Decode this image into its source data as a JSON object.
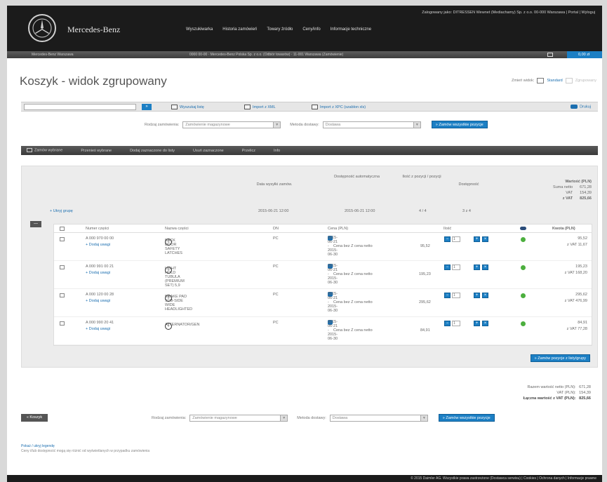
{
  "header": {
    "brand": "Mercedes-Benz",
    "top_links": "Zalogowany jako: DITRESSEN Wewnet (Mediachamy) Sp. z o.o. 00-000 Warszawa  |  Portal  |  Wyloguj",
    "nav": [
      "Wyszukiwarka",
      "Historia zamówień",
      "Towary źródło",
      "Ceny/info",
      "Informacje techniczne"
    ],
    "sub_left": "Mercedes-Benz Warszawa",
    "sub_mid": "0000 00-00 · Mercedes-Benz Polska Sp. z o.o. (Odbiór towarów) · 11-001 Warszawa (Zamówienie)",
    "cart_label": "0,00 zł"
  },
  "page": {
    "title": "Koszyk - widok zgrupowany",
    "view_label": "Zmień widok:",
    "view_standard": "Standard",
    "view_grouped": "Zgrupowany"
  },
  "actions": {
    "search_placeholder": "",
    "search_btn": "»",
    "link1": "Wyszukaj listę",
    "link2": "Import z XML",
    "link3": "Import z XPC (szablon xls)",
    "print": "Drukuj"
  },
  "filters": {
    "sort_label": "Rodzaj zamówienia:",
    "sort_value": "Zamówienie magazynowe",
    "delivery_label": "Metoda dostawy:",
    "delivery_value": "Dostawa",
    "submit": "» Zamów wszystkie pozycje"
  },
  "toolbar": [
    "Zamów wybrane",
    "Przenieś wybrane",
    "Dodaj zaznaczone do listy",
    "Usuń zaznaczone",
    "Przelicz",
    "Info"
  ],
  "group": {
    "headers": {
      "delivery_date": "Data wysyłki zamów.",
      "delivery_avail": "Dostępność automatyczna",
      "items": "Ilość z pozycji / pozycji",
      "availability": "Dostępność",
      "value": "Wartość (PLN)"
    },
    "totals": [
      {
        "label": "Suma netto",
        "value": "671,28"
      },
      {
        "label": "VAT",
        "value": "154,39"
      },
      {
        "label": "z VAT",
        "value": "825,66"
      }
    ],
    "link": "+ Ukryj grupę",
    "date1": "2015-06-21 12:00",
    "date2": "2015-06-21 12:00",
    "count": "4 / 4",
    "avail": "3 z 4",
    "collapse": "—"
  },
  "table": {
    "headers": {
      "part": "Numer części",
      "name": "Nazwa części",
      "dn": "DN",
      "price": "Cena (PLN)",
      "qty": "Ilość",
      "value": "Kwota (PLN)"
    },
    "rows": [
      {
        "part": "A 000 970 00 00",
        "link": "+ Dodaj uwagi",
        "name": "BACK DOOR SAFETY LATCHES",
        "dn": "PC",
        "date": "2015-06-21 - 2015-06-30",
        "price_label": "Cena bez Z cena netto",
        "price": "95,52",
        "qty": "1",
        "amount": "95,52",
        "amount_vat": "z VAT 11,67"
      },
      {
        "part": "A 000 991 00 21",
        "link": "+ Dodaj uwagi",
        "name": "LIGHT HOLD TUBULA (PREMIUM SET) 5,9",
        "dn": "PC",
        "date": "2015-06-21 - 2015-06-30",
        "price_label": "Cena bez Z cena netto",
        "price": "195,23",
        "qty": "1",
        "amount": "195,23",
        "amount_vat": "z VAT 168,20"
      },
      {
        "part": "A 000 120 00 28",
        "link": "+ Dodaj uwagi",
        "name": "BRAKE PAD SUB-SIDE WIDE HEADLIGHTED",
        "dn": "PC",
        "date": "2015-06-21 - 2015-06-30",
        "price_label": "Cena bez Z cena netto",
        "price": "295,62",
        "qty": "1",
        "amount": "295,62",
        "amount_vat": "z VAT 476,99"
      },
      {
        "part": "A 000 990 20 41",
        "link": "+ Dodaj uwagi",
        "name": "ALTERNATOR/GEN",
        "dn": "PC",
        "date": "2015-06-21 - 2015-06-30",
        "price_label": "Cena bez Z cena netto",
        "price": "84,91",
        "qty": "1",
        "amount": "84,91",
        "amount_vat": "z VAT 77,28"
      }
    ],
    "add_btn": "» Zamów pozycje z listy/grupy"
  },
  "summary": [
    {
      "label": "Razem wartość netto (PLN):",
      "value": "671,28"
    },
    {
      "label": "VAT (PLN):",
      "value": "154,39"
    },
    {
      "label": "Łączna wartość z VAT (PLN):",
      "value": "825,66"
    }
  ],
  "bottom": {
    "back": "« Koszyk",
    "sort_label": "Rodzaj zamówienia:",
    "sort_value": "Zamówienie magazynowe",
    "delivery_label": "Metoda dostawy:",
    "delivery_value": "Dostawa",
    "submit": "» Zamów wszystkie pozycje"
  },
  "note": {
    "line1": "Pokaż / ukryj legendę",
    "line2": "Ceny i/lub dostępność mogą się różnić od wyświetlanych w przypadku zamówienia"
  },
  "footer": "© 2015 Daimler AG. Wszystkie prawa zastrzeżone (Dostawca serwisu)   |   Cookies   |   Ochrona danych   |   Informacje prawne"
}
